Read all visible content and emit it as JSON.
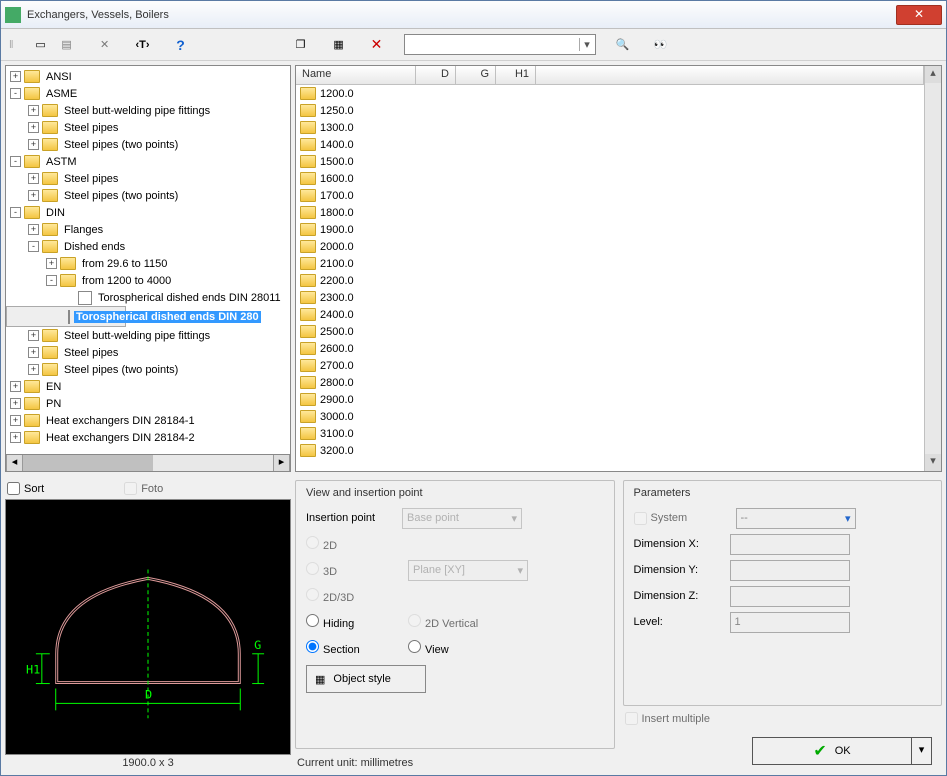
{
  "window": {
    "title": "Exchangers, Vessels, Boilers"
  },
  "toolbar": {
    "search_placeholder": ""
  },
  "tree": {
    "nodes": [
      {
        "depth": 0,
        "exp": "+",
        "label": "ANSI"
      },
      {
        "depth": 0,
        "exp": "-",
        "label": "ASME"
      },
      {
        "depth": 1,
        "exp": "+",
        "label": "Steel butt-welding pipe fittings"
      },
      {
        "depth": 1,
        "exp": "+",
        "label": "Steel pipes"
      },
      {
        "depth": 1,
        "exp": "+",
        "label": "Steel pipes (two points)"
      },
      {
        "depth": 0,
        "exp": "-",
        "label": "ASTM"
      },
      {
        "depth": 1,
        "exp": "+",
        "label": "Steel pipes"
      },
      {
        "depth": 1,
        "exp": "+",
        "label": "Steel pipes (two points)"
      },
      {
        "depth": 0,
        "exp": "-",
        "label": "DIN"
      },
      {
        "depth": 1,
        "exp": "+",
        "label": "Flanges"
      },
      {
        "depth": 1,
        "exp": "-",
        "label": "Dished ends"
      },
      {
        "depth": 2,
        "exp": "+",
        "label": "from 29.6 to 1150"
      },
      {
        "depth": 2,
        "exp": "-",
        "label": "from 1200 to 4000"
      },
      {
        "depth": 3,
        "exp": "",
        "leaf": true,
        "label": "Torospherical dished ends DIN 28011"
      },
      {
        "depth": 3,
        "exp": "",
        "leaf": true,
        "sel": true,
        "label": "Torospherical dished ends DIN 280"
      },
      {
        "depth": 1,
        "exp": "+",
        "label": "Steel butt-welding pipe fittings"
      },
      {
        "depth": 1,
        "exp": "+",
        "label": "Steel pipes"
      },
      {
        "depth": 1,
        "exp": "+",
        "label": "Steel pipes (two points)"
      },
      {
        "depth": 0,
        "exp": "+",
        "label": "EN"
      },
      {
        "depth": 0,
        "exp": "+",
        "label": "PN"
      },
      {
        "depth": 0,
        "exp": "+",
        "label": "Heat exchangers DIN 28184-1"
      },
      {
        "depth": 0,
        "exp": "+",
        "label": "Heat exchangers DIN 28184-2"
      }
    ]
  },
  "list": {
    "headers": [
      "Name",
      "D",
      "G",
      "H1"
    ],
    "rows": [
      "1200.0",
      "1250.0",
      "1300.0",
      "1400.0",
      "1500.0",
      "1600.0",
      "1700.0",
      "1800.0",
      "1900.0",
      "2000.0",
      "2100.0",
      "2200.0",
      "2300.0",
      "2400.0",
      "2500.0",
      "2600.0",
      "2700.0",
      "2800.0",
      "2900.0",
      "3000.0",
      "3100.0",
      "3200.0"
    ]
  },
  "sortrow": {
    "sort": "Sort",
    "foto": "Foto"
  },
  "preview": {
    "label": "1900.0 x 3",
    "dim_d": "D",
    "dim_g": "G",
    "dim_h1": "H1"
  },
  "viewgroup": {
    "title": "View and insertion point",
    "insertion_point": "Insertion point",
    "base_point": "Base point",
    "r2d": "2D",
    "r3d": "3D",
    "r2d3d": "2D/3D",
    "plane": "Plane  [XY]",
    "hiding": "Hiding",
    "r2dvert": "2D Vertical",
    "section": "Section",
    "view": "View",
    "objstyle": "Object style",
    "curunit": "Current unit: millimetres"
  },
  "params": {
    "title": "Parameters",
    "system": "System",
    "system_val": "--",
    "dimx": "Dimension X:",
    "dimy": "Dimension Y:",
    "dimz": "Dimension Z:",
    "level": "Level:",
    "level_val": "1",
    "insert_multiple": "Insert multiple",
    "ok": "OK"
  }
}
